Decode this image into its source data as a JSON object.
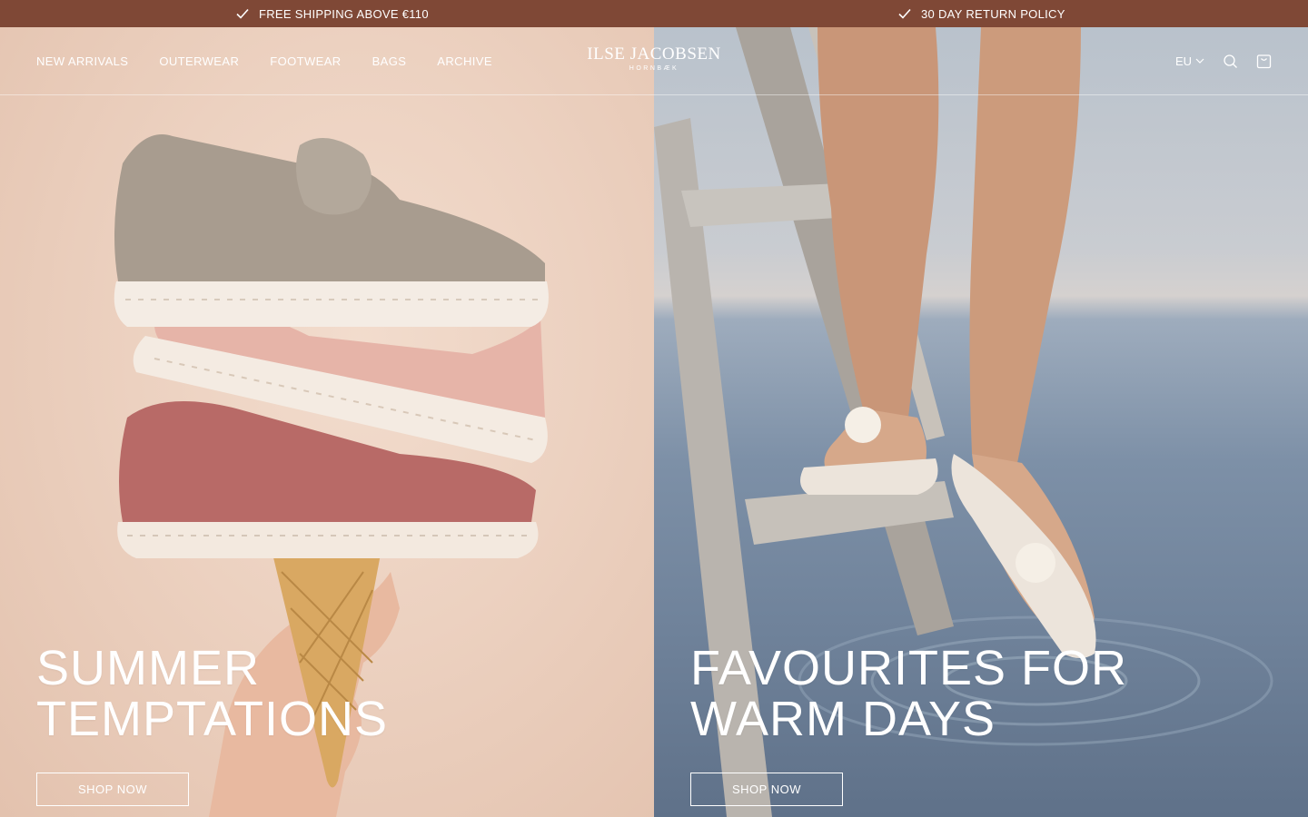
{
  "announcements": [
    {
      "text": "FREE SHIPPING ABOVE €110",
      "icon": "check-icon"
    },
    {
      "text": "30 DAY RETURN POLICY",
      "icon": "check-icon"
    }
  ],
  "nav": {
    "items": [
      "NEW ARRIVALS",
      "OUTERWEAR",
      "FOOTWEAR",
      "BAGS",
      "ARCHIVE"
    ]
  },
  "brand": {
    "name": "ILSE JACOBSEN",
    "tagline": "HORNBÆK"
  },
  "header_actions": {
    "region": "EU",
    "icons": [
      "chevron-down-icon",
      "search-icon",
      "bag-icon"
    ]
  },
  "heroes": [
    {
      "title_line1": "SUMMER",
      "title_line2": "TEMPTATIONS",
      "button": "SHOP NOW"
    },
    {
      "title_line1": "FAVOURITES FOR",
      "title_line2": "WARM DAYS",
      "button": "SHOP NOW"
    }
  ],
  "colors": {
    "announcement_bg": "#7f4836",
    "text": "#ffffff",
    "left_panel": "#ecd1c0",
    "right_panel_water": "#7d90a7"
  }
}
